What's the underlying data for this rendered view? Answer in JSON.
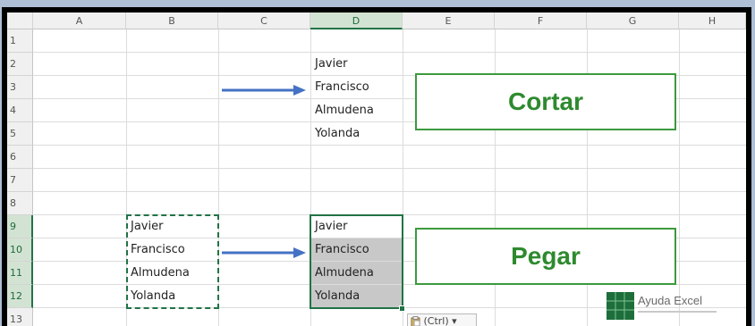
{
  "columns": [
    "A",
    "B",
    "C",
    "D",
    "E",
    "F",
    "G",
    "H"
  ],
  "rows": [
    "1",
    "2",
    "3",
    "4",
    "5",
    "6",
    "7",
    "8",
    "9",
    "10",
    "11",
    "12",
    "13"
  ],
  "source_list": [
    "Javier",
    "Francisco",
    "Almudena",
    "Yolanda"
  ],
  "copied_list": [
    "Javier",
    "Francisco",
    "Almudena",
    "Yolanda"
  ],
  "pasted_list": [
    "Javier",
    "Francisco",
    "Almudena",
    "Yolanda"
  ],
  "labels": {
    "cut": "Cortar",
    "paste": "Pegar"
  },
  "paste_options": {
    "icon": "clipboard-icon",
    "text": "(Ctrl)",
    "caret": "▾"
  },
  "logo": {
    "name": "Ayuda Excel"
  },
  "colors": {
    "excel_green": "#217346",
    "label_green": "#3c9a3c",
    "arrow_blue": "#4472c4",
    "selection_grey": "#c8c8c8",
    "background": "#aebfd6"
  }
}
